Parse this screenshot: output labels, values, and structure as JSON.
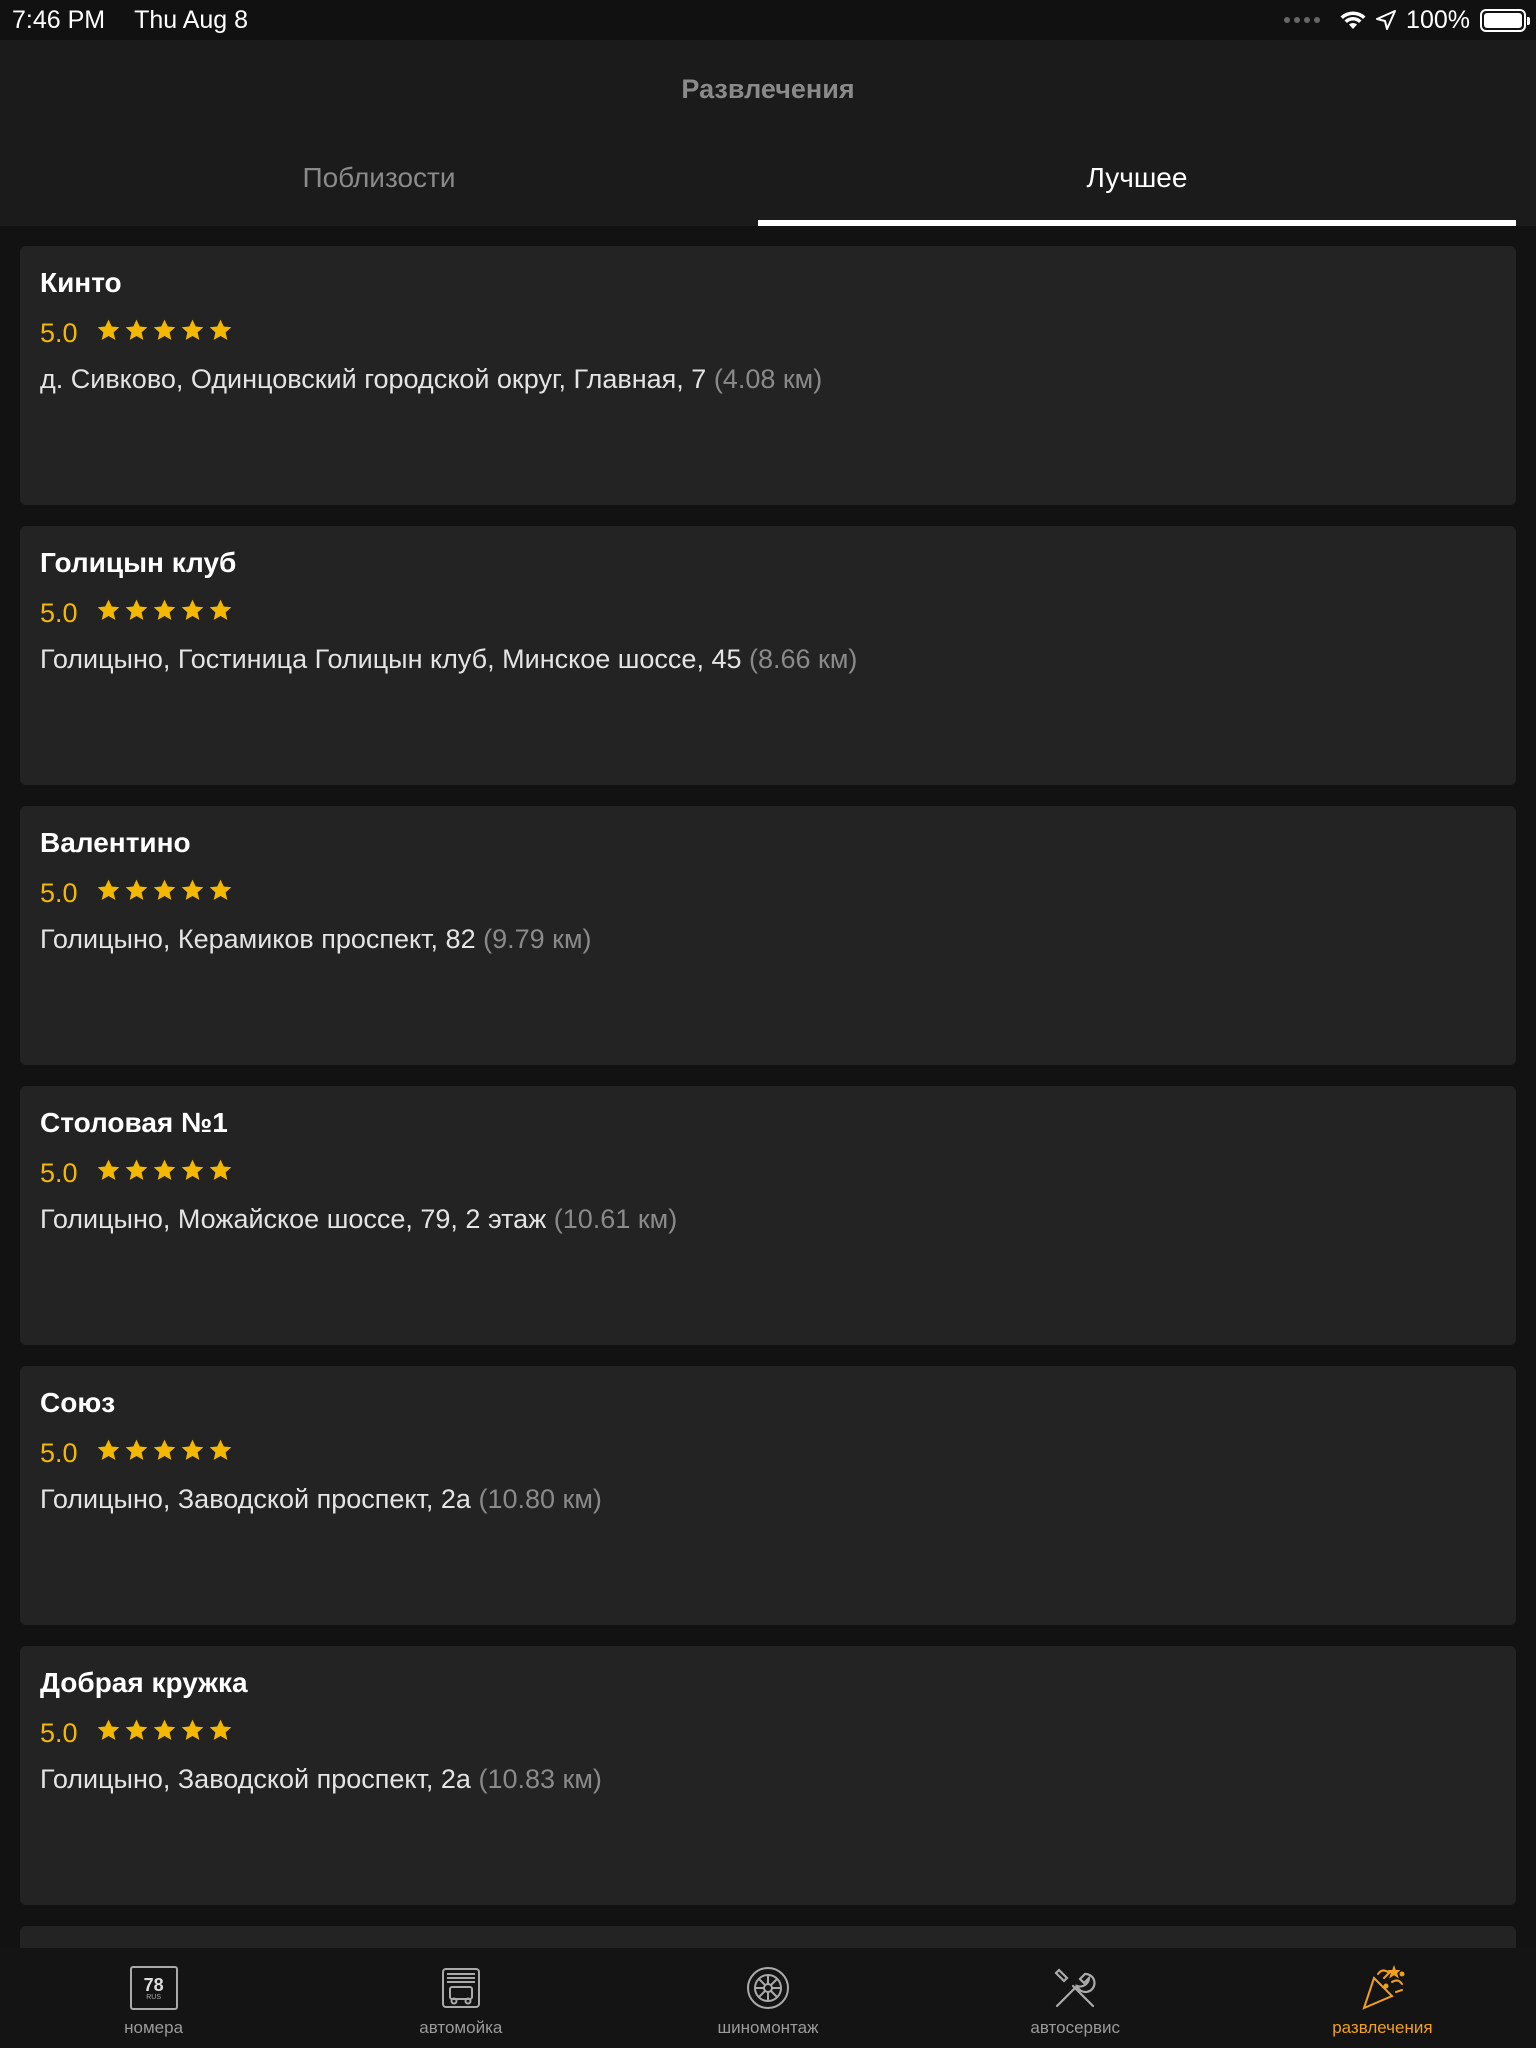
{
  "status_bar": {
    "time": "7:46 PM",
    "date": "Thu Aug 8",
    "battery": "100%"
  },
  "header": {
    "title": "Развлечения",
    "tabs": [
      {
        "label": "Поблизости",
        "active": false
      },
      {
        "label": "Лучшее",
        "active": true
      }
    ]
  },
  "places": [
    {
      "name": "Кинто",
      "rating": "5.0",
      "stars": 5,
      "address": "д. Сивково, Одинцовский городской округ, Главная, 7",
      "distance": "(4.08 км)"
    },
    {
      "name": "Голицын клуб",
      "rating": "5.0",
      "stars": 5,
      "address": "Голицыно, Гостиница Голицын клуб, Минское шоссе, 45",
      "distance": "(8.66 км)"
    },
    {
      "name": "Валентино",
      "rating": "5.0",
      "stars": 5,
      "address": "Голицыно, Керамиков проспект, 82",
      "distance": "(9.79 км)"
    },
    {
      "name": "Столовая №1",
      "rating": "5.0",
      "stars": 5,
      "address": "Голицыно, Можайское шоссе, 79, 2 этаж",
      "distance": "(10.61 км)"
    },
    {
      "name": "Союз",
      "rating": "5.0",
      "stars": 5,
      "address": "Голицыно, Заводской проспект, 2а",
      "distance": "(10.80 км)"
    },
    {
      "name": "Добрая кружка",
      "rating": "5.0",
      "stars": 5,
      "address": "Голицыно, Заводской проспект, 2а",
      "distance": "(10.83 км)"
    }
  ],
  "tab_bar": {
    "items": [
      {
        "label": "номера",
        "icon": "license-plate-icon",
        "plate_number": "78",
        "plate_region": "RUS",
        "active": false
      },
      {
        "label": "автомойка",
        "icon": "car-wash-icon",
        "active": false
      },
      {
        "label": "шиномонтаж",
        "icon": "tire-icon",
        "active": false
      },
      {
        "label": "автосервис",
        "icon": "wrench-screwdriver-icon",
        "active": false
      },
      {
        "label": "развлечения",
        "icon": "party-popper-icon",
        "active": true
      }
    ]
  },
  "colors": {
    "accent": "#f5b800",
    "tab_active": "#f0a01c",
    "card_bg": "#232323",
    "background": "#121212"
  }
}
